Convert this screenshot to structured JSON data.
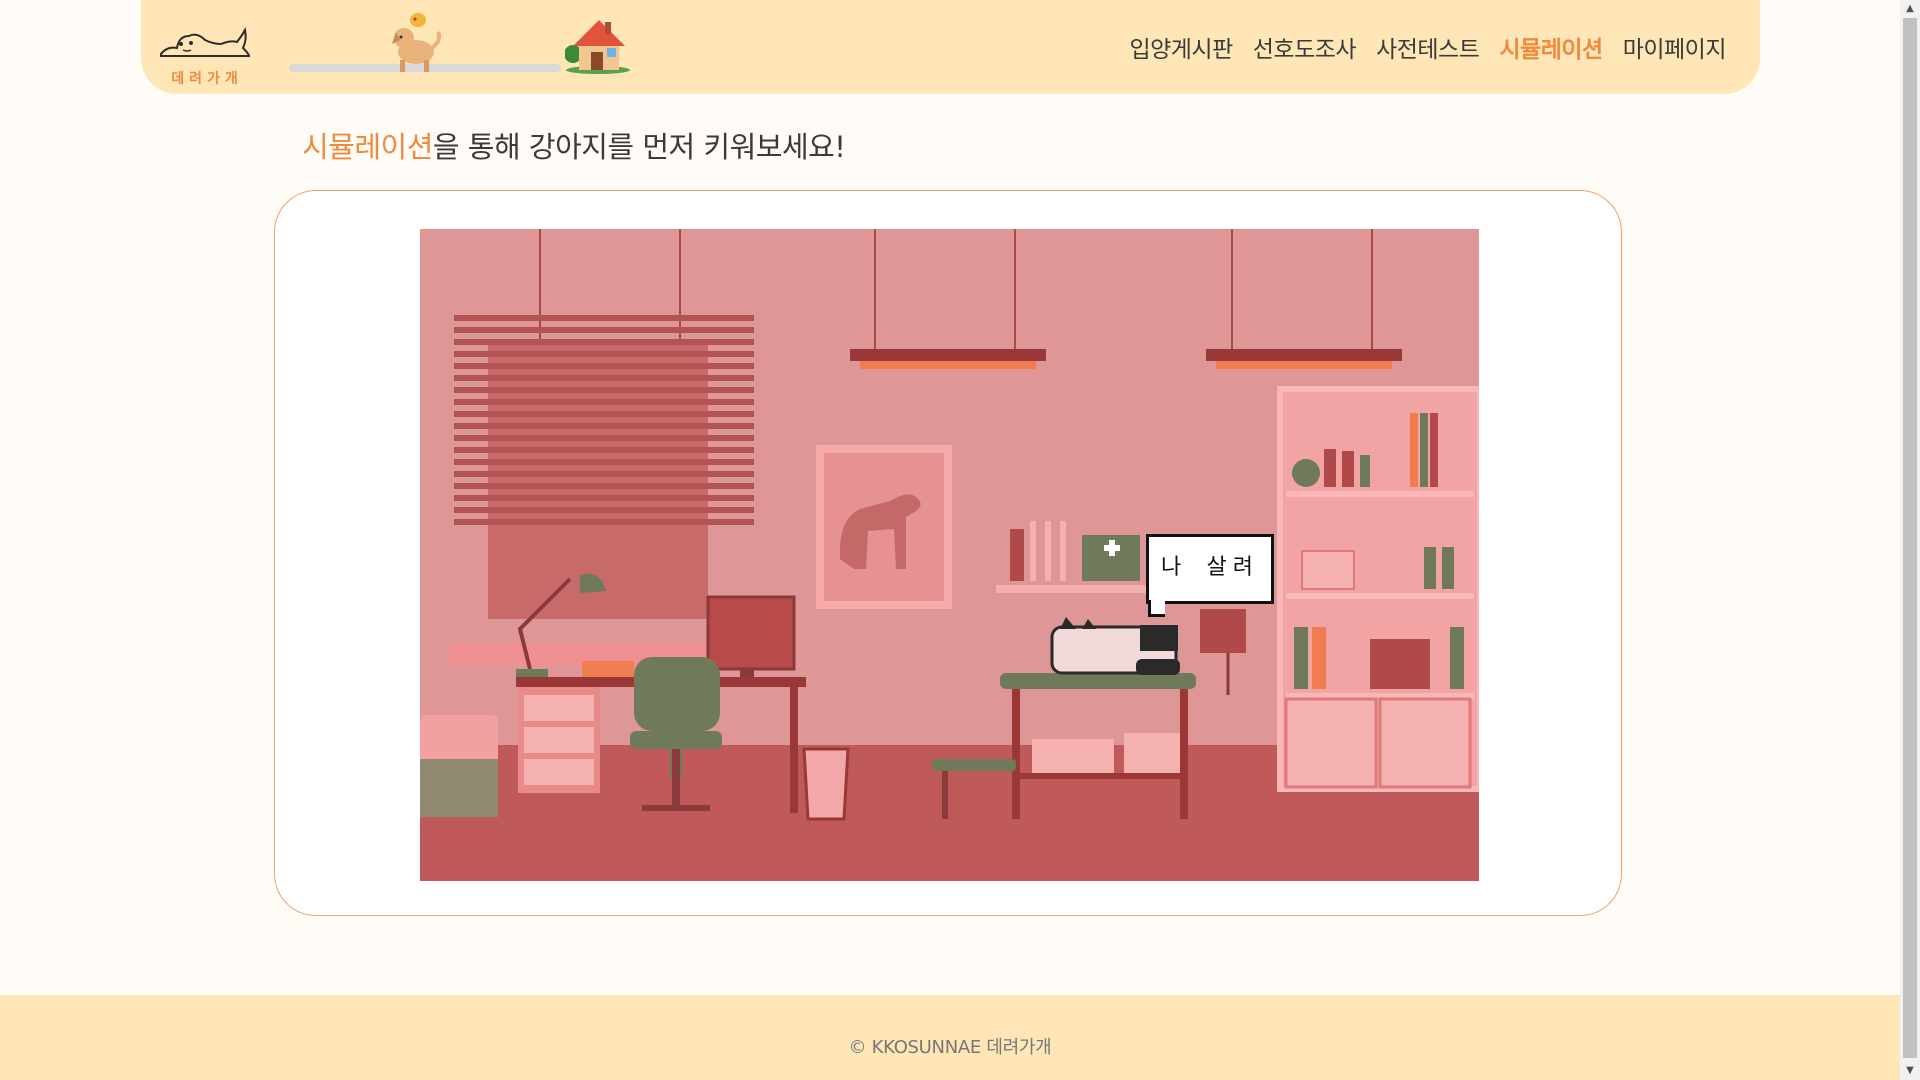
{
  "header": {
    "logo_text": "데려가개",
    "nav": [
      {
        "label": "입양게시판"
      },
      {
        "label": "선호도조사"
      },
      {
        "label": "사전테스트"
      },
      {
        "label": "시뮬레이션",
        "active": true
      },
      {
        "label": "마이페이지"
      }
    ]
  },
  "heading": {
    "accent": "시뮬레이션",
    "rest": "을 통해 강아지를 먼저 키워보세요!"
  },
  "simulation": {
    "speech_bubble": "나 살려"
  },
  "footer": {
    "copyright": "© KKOSUNNAE 데려가개"
  },
  "colors": {
    "accent": "#f08a3c",
    "header_bg": "#ffe6b6",
    "page_bg": "#fffbf6",
    "scene_wall": "#df9696",
    "scene_floor": "#c05a5a"
  },
  "icons": [
    "dog-logo-icon",
    "dog-progress-icon",
    "house-goal-icon"
  ]
}
